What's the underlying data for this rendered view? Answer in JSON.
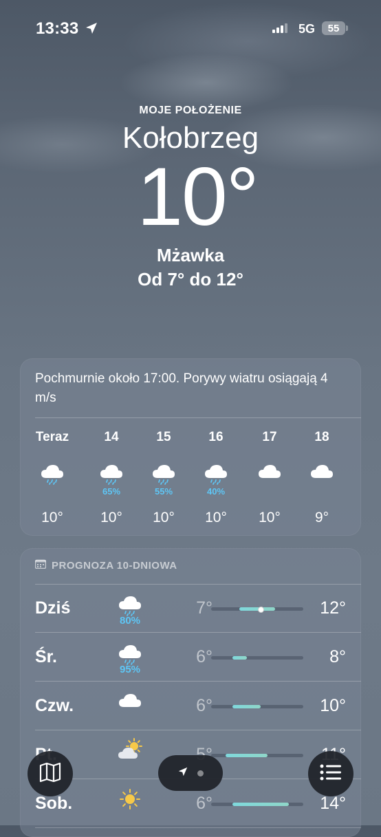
{
  "status_bar": {
    "time": "13:33",
    "network": "5G",
    "battery": "55"
  },
  "header": {
    "place_label": "MOJE POŁOŻENIE",
    "city": "Kołobrzeg",
    "temperature": "10°",
    "condition": "Mżawka",
    "range": "Od 7° do 12°"
  },
  "hourly": {
    "summary": "Pochmurnie około 17:00. Porywy wiatru osiągają 4 m/s",
    "hours": [
      {
        "label": "Teraz",
        "icon": "cloud-drizzle-icon",
        "prob": "",
        "temp": "10°"
      },
      {
        "label": "14",
        "icon": "cloud-rain-icon",
        "prob": "65%",
        "temp": "10°"
      },
      {
        "label": "15",
        "icon": "cloud-rain-icon",
        "prob": "55%",
        "temp": "10°"
      },
      {
        "label": "16",
        "icon": "cloud-rain-icon",
        "prob": "40%",
        "temp": "10°"
      },
      {
        "label": "17",
        "icon": "cloud-icon",
        "prob": "",
        "temp": "10°"
      },
      {
        "label": "18",
        "icon": "cloud-icon",
        "prob": "",
        "temp": "9°"
      }
    ]
  },
  "daily": {
    "title": "PROGNOZA 10-DNIOWA",
    "days": [
      {
        "day": "Dziś",
        "icon": "cloud-rain-icon",
        "prob": "80%",
        "low": "7°",
        "high": "12°",
        "current": "10°"
      },
      {
        "day": "Śr.",
        "icon": "cloud-rain-icon",
        "prob": "95%",
        "low": "6°",
        "high": "8°"
      },
      {
        "day": "Czw.",
        "icon": "cloud-icon",
        "prob": "",
        "low": "6°",
        "high": "10°"
      },
      {
        "day": "Pt.",
        "icon": "partly-sunny-icon",
        "prob": "",
        "low": "5°",
        "high": "11°"
      },
      {
        "day": "Sob.",
        "icon": "sun-icon",
        "prob": "",
        "low": "6°",
        "high": "14°"
      }
    ]
  },
  "colors": {
    "precip": "#5ec6f5",
    "temp_bar": "#7fd8dc"
  }
}
